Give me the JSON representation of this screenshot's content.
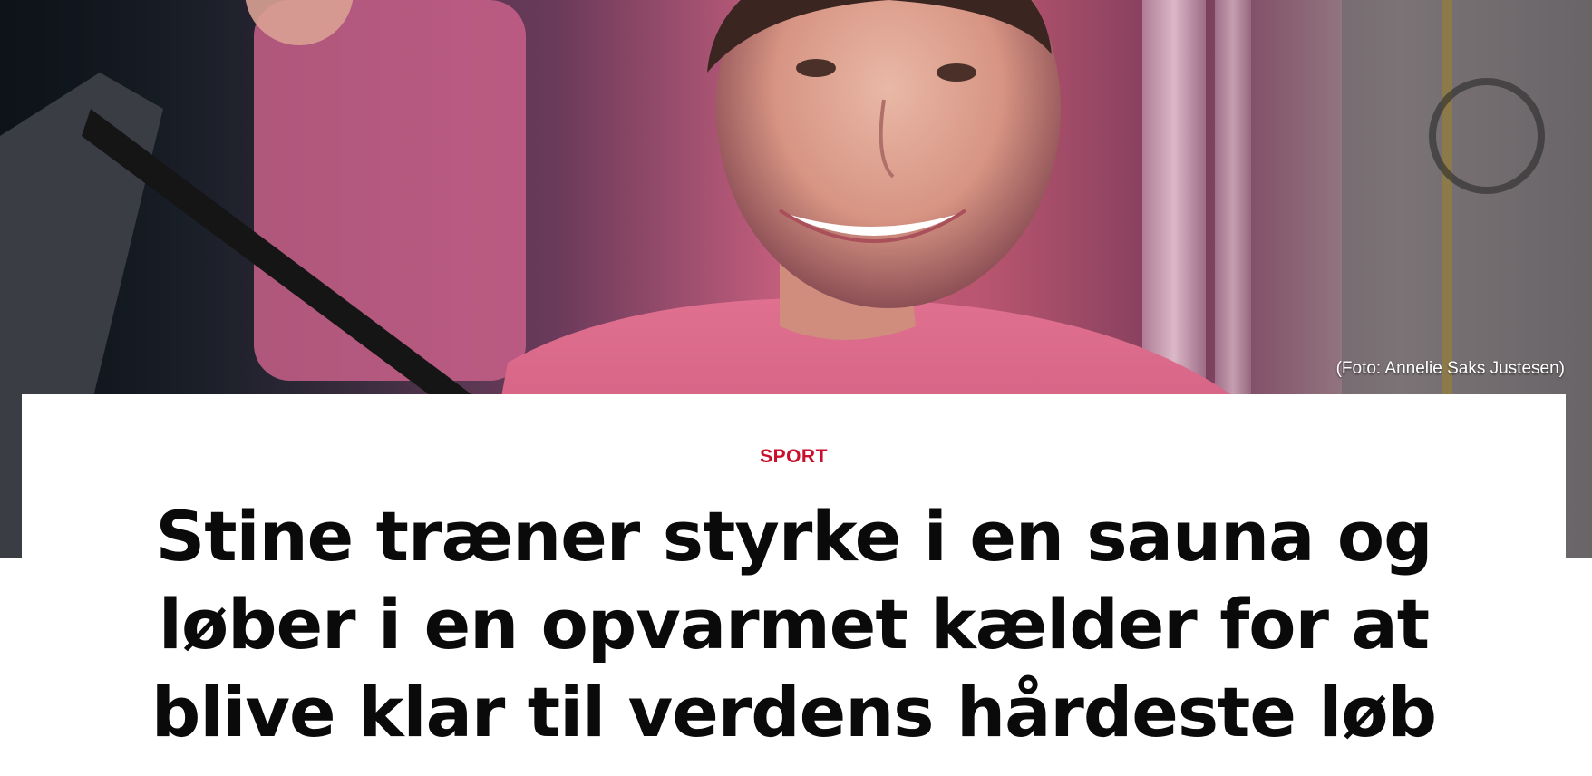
{
  "hero": {
    "image_alt": "Smilende kvinde i lyserød t-shirt på løbebånd",
    "photo_credit": "(Foto: Annelie Saks Justesen)"
  },
  "article": {
    "category": "SPORT",
    "headline_lines": [
      "Stine træner styrke i en sauna og",
      "løber i en opvarmet kælder for at",
      "blive klar til verdens hårdeste løb"
    ]
  },
  "colors": {
    "category_red": "#c8102e",
    "headline_black": "#0a0a0a",
    "card_white": "#ffffff"
  }
}
